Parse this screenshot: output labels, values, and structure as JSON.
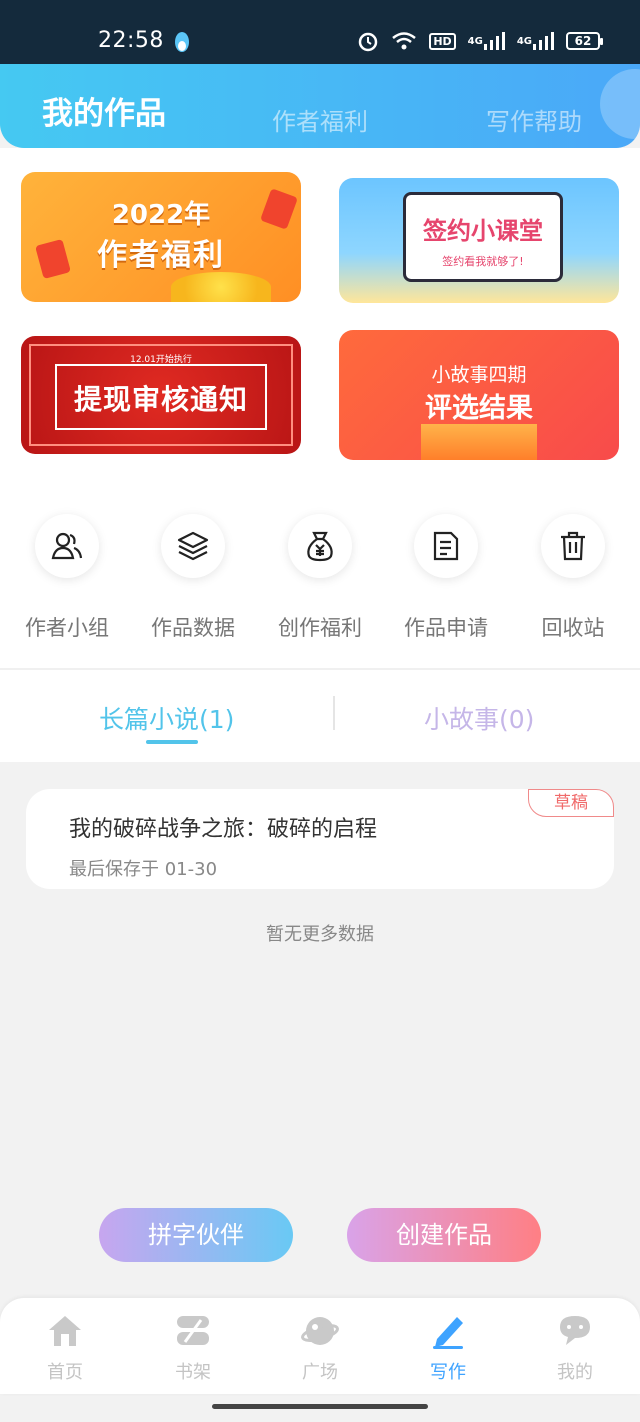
{
  "status_bar": {
    "time": "22:58",
    "network_1": "4G",
    "network_2": "4G",
    "hd": "HD",
    "battery": "62"
  },
  "header": {
    "tabs": [
      {
        "label": "我的作品",
        "active": true
      },
      {
        "label": "作者福利",
        "active": false
      },
      {
        "label": "写作帮助",
        "active": false
      }
    ]
  },
  "banners": {
    "welfare": {
      "line1": "2022年",
      "line2": "作者福利"
    },
    "course": {
      "title": "签约小课堂",
      "subtitle": "签约看我就够了!"
    },
    "notice": {
      "tag": "12.01开始执行",
      "title": "提现审核通知"
    },
    "result": {
      "line1": "小故事四期",
      "line2": "评选结果"
    }
  },
  "quick_actions": [
    {
      "label": "作者小组",
      "icon": "group-icon"
    },
    {
      "label": "作品数据",
      "icon": "layers-icon"
    },
    {
      "label": "创作福利",
      "icon": "money-bag-icon"
    },
    {
      "label": "作品申请",
      "icon": "document-icon"
    },
    {
      "label": "回收站",
      "icon": "trash-icon"
    }
  ],
  "work_tabs": [
    {
      "label": "长篇小说(1)",
      "active": true
    },
    {
      "label": "小故事(0)",
      "active": false
    }
  ],
  "works": [
    {
      "title": "我的破碎战争之旅：破碎的启程",
      "saved": "最后保存于 01-30",
      "badge": "草稿"
    }
  ],
  "empty_text": "暂无更多数据",
  "buttons": {
    "partner": "拼字伙伴",
    "create": "创建作品"
  },
  "nav": [
    {
      "label": "首页",
      "icon": "home-icon"
    },
    {
      "label": "书架",
      "icon": "bookshelf-icon"
    },
    {
      "label": "广场",
      "icon": "planet-icon"
    },
    {
      "label": "写作",
      "icon": "pen-icon",
      "active": true
    },
    {
      "label": "我的",
      "icon": "chat-bubble-icon"
    }
  ],
  "colors": {
    "accent": "#52c4ea",
    "nav_active": "#3ea3ff",
    "tab_inactive": "#c5b6e8",
    "draft_badge": "#f06a6a"
  }
}
